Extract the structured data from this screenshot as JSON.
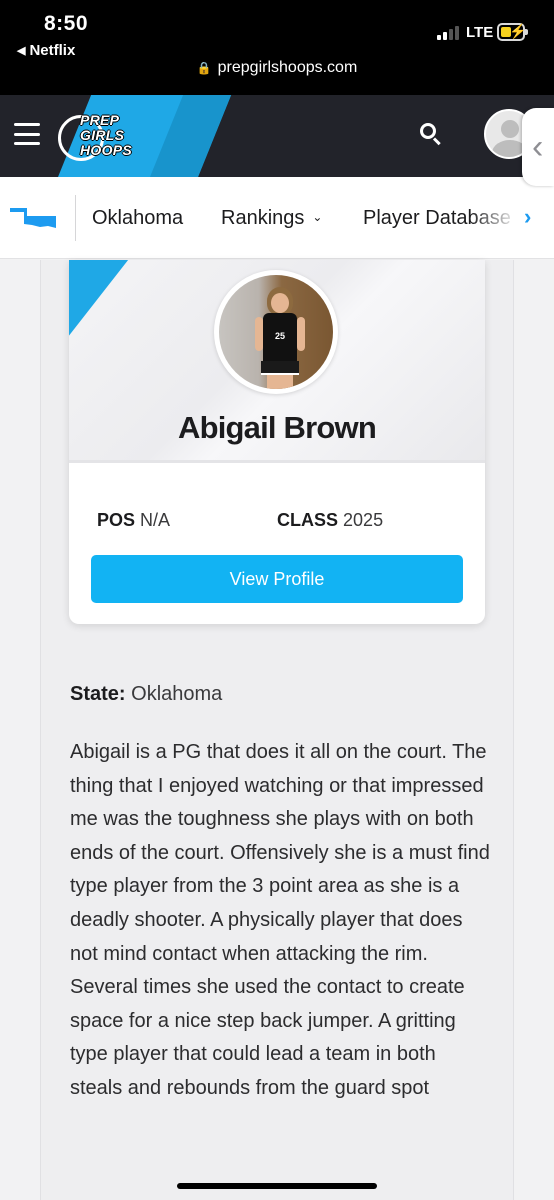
{
  "status_bar": {
    "time": "8:50",
    "back_app": "Netflix",
    "network": "LTE"
  },
  "browser": {
    "url": "prepgirlshoops.com"
  },
  "header": {
    "logo_text": [
      "PREP",
      "GIRLS",
      "HOOPS"
    ],
    "accent_color": "#1fa8e6"
  },
  "subnav": {
    "items": [
      {
        "label": "Oklahoma"
      },
      {
        "label": "Rankings"
      },
      {
        "label": "Player Database"
      }
    ]
  },
  "profile": {
    "name": "Abigail Brown",
    "photo_jersey_number": "25",
    "pos_label": "POS",
    "pos_value": "N/A",
    "class_label": "CLASS",
    "class_value": "2025",
    "button_label": "View Profile",
    "button_color": "#12b3f3"
  },
  "details": {
    "state_label": "State:",
    "state_value": "Oklahoma",
    "bio": "Abigail is a PG that does it all on the court.  The thing that I enjoyed watching or that impressed me was the toughness she plays with on both ends of the court.  Offensively she is a must find type player from the 3 point area as she is a deadly shooter.  A physically player that does not mind contact when attacking the rim.  Several times she used the contact to create space for a nice step back jumper.  A gritting type player that could lead a team in both steals and rebounds from the guard spot"
  }
}
